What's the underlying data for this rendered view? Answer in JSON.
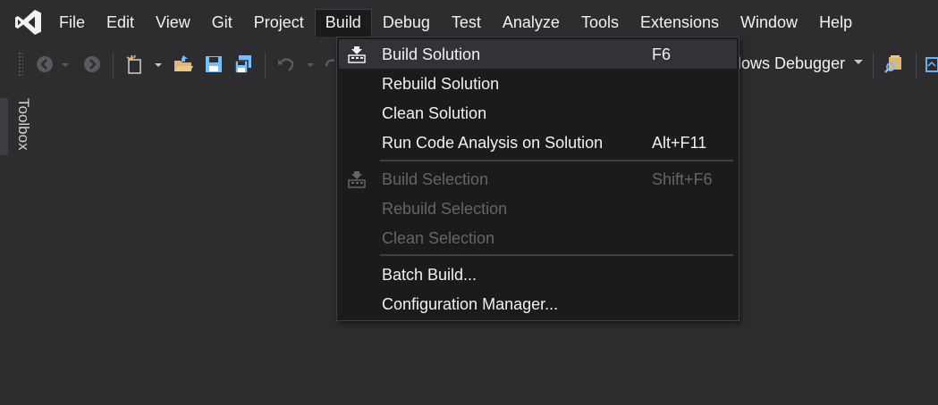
{
  "menubar": {
    "items": [
      {
        "label": "File"
      },
      {
        "label": "Edit"
      },
      {
        "label": "View"
      },
      {
        "label": "Git"
      },
      {
        "label": "Project"
      },
      {
        "label": "Build"
      },
      {
        "label": "Debug"
      },
      {
        "label": "Test"
      },
      {
        "label": "Analyze"
      },
      {
        "label": "Tools"
      },
      {
        "label": "Extensions"
      },
      {
        "label": "Window"
      },
      {
        "label": "Help"
      }
    ],
    "active": "Build"
  },
  "toolbar": {
    "debugger_label": "lows Debugger"
  },
  "toolbox": {
    "label": "Toolbox"
  },
  "build_menu": {
    "items": [
      {
        "label": "Build Solution",
        "shortcut": "F6",
        "icon": "build-icon",
        "enabled": true,
        "highlighted": true
      },
      {
        "label": "Rebuild Solution",
        "shortcut": "",
        "enabled": true
      },
      {
        "label": "Clean Solution",
        "shortcut": "",
        "enabled": true
      },
      {
        "label": "Run Code Analysis on Solution",
        "shortcut": "Alt+F11",
        "enabled": true
      },
      {
        "label": "Build Selection",
        "shortcut": "Shift+F6",
        "icon": "build-icon",
        "enabled": false
      },
      {
        "label": "Rebuild Selection",
        "shortcut": "",
        "enabled": false
      },
      {
        "label": "Clean Selection",
        "shortcut": "",
        "enabled": false
      },
      {
        "label": "Batch Build...",
        "shortcut": "",
        "enabled": true
      },
      {
        "label": "Configuration Manager...",
        "shortcut": "",
        "enabled": true
      }
    ]
  },
  "colors": {
    "background": "#2d2d30",
    "menu_background": "#1b1b1c",
    "highlight": "#333337",
    "accent_purple": "#ffffff",
    "icon_blue": "#75beff",
    "icon_orange": "#dcb67a"
  }
}
